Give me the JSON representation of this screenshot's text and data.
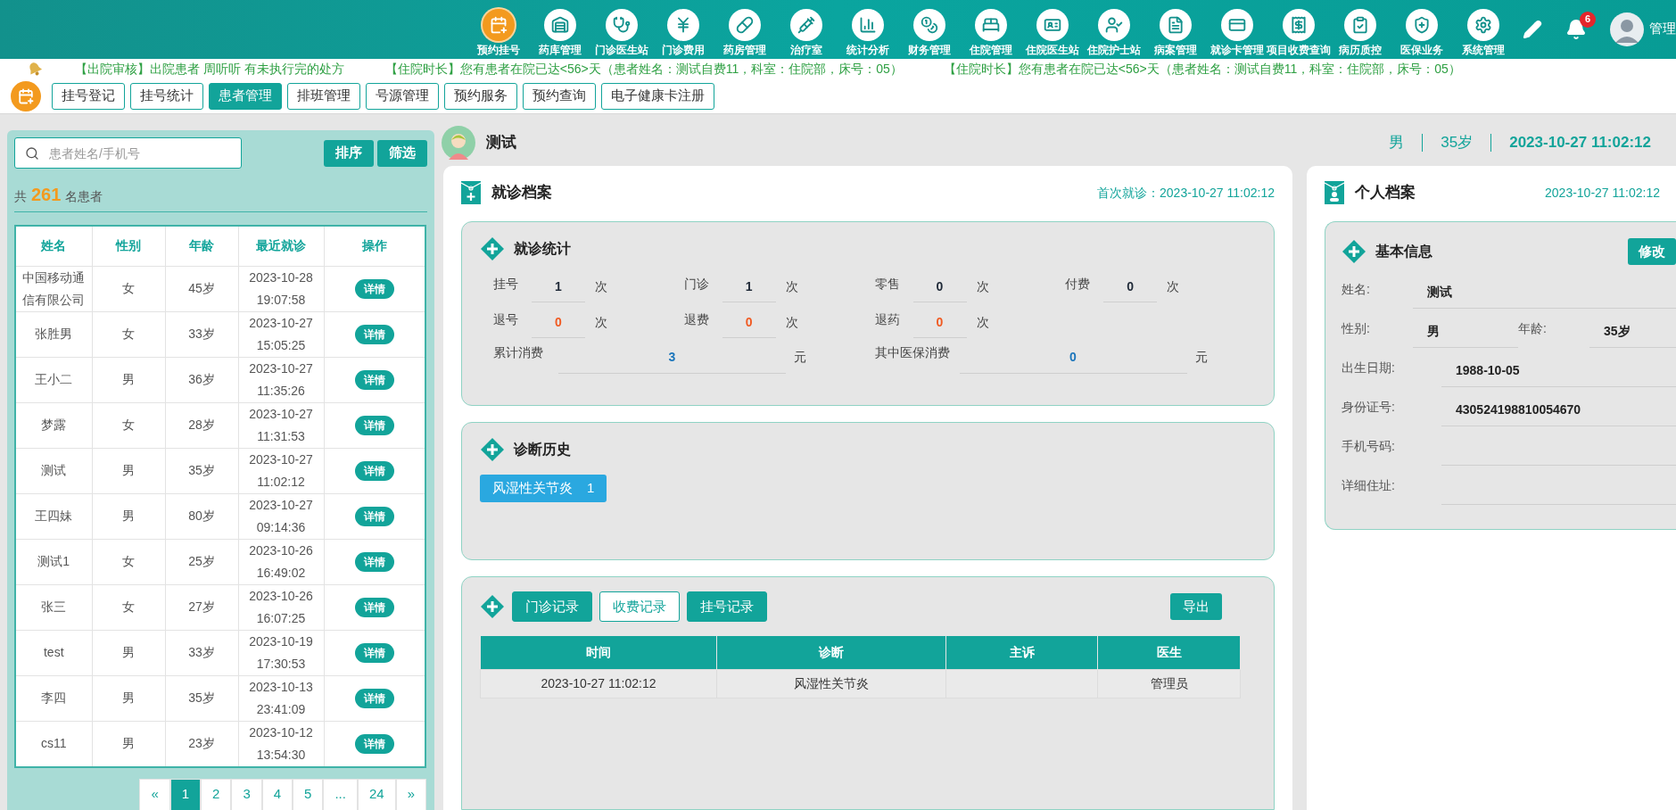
{
  "nav": {
    "items": [
      {
        "label": "预约挂号",
        "selected": true
      },
      {
        "label": "药库管理",
        "selected": false
      },
      {
        "label": "门诊医生站",
        "selected": false
      },
      {
        "label": "门诊费用",
        "selected": false
      },
      {
        "label": "药房管理",
        "selected": false
      },
      {
        "label": "治疗室",
        "selected": false
      },
      {
        "label": "统计分析",
        "selected": false
      },
      {
        "label": "财务管理",
        "selected": false
      },
      {
        "label": "住院管理",
        "selected": false
      },
      {
        "label": "住院医生站",
        "selected": false
      },
      {
        "label": "住院护士站",
        "selected": false
      },
      {
        "label": "病案管理",
        "selected": false
      },
      {
        "label": "就诊卡管理",
        "selected": false
      },
      {
        "label": "项目收费查询",
        "selected": false
      },
      {
        "label": "病历质控",
        "selected": false
      },
      {
        "label": "医保业务",
        "selected": false
      },
      {
        "label": "系统管理",
        "selected": false
      }
    ],
    "notification_count": "6",
    "user": "管理"
  },
  "ticker": [
    "【出院审核】出院患者 周听听 有未执行完的处方",
    "【住院时长】您有患者在院已达<56>天（患者姓名：测试自费11，科室：住院部，床号：05）",
    "【住院时长】您有患者在院已达<56>天（患者姓名：测试自费11，科室：住院部，床号：05）"
  ],
  "tabs": [
    {
      "label": "挂号登记",
      "selected": false
    },
    {
      "label": "挂号统计",
      "selected": false
    },
    {
      "label": "患者管理",
      "selected": true
    },
    {
      "label": "排班管理",
      "selected": false
    },
    {
      "label": "号源管理",
      "selected": false
    },
    {
      "label": "预约服务",
      "selected": false
    },
    {
      "label": "预约查询",
      "selected": false
    },
    {
      "label": "电子健康卡注册",
      "selected": false
    }
  ],
  "patient_list": {
    "search": {
      "placeholder": "患者姓名/手机号"
    },
    "buttons": [
      "排序",
      "筛选"
    ],
    "count": {
      "prefix": "共",
      "value": "261",
      "suffix": "名患者"
    },
    "columns": [
      "姓名",
      "性别",
      "年龄",
      "最近就诊",
      "操作"
    ],
    "rows": [
      {
        "name": "中国移动通信有限公司",
        "sex": "女",
        "age": "45岁",
        "date": "2023-10-28",
        "time": "19:07:58",
        "action": "详情"
      },
      {
        "name": "张胜男",
        "sex": "女",
        "age": "33岁",
        "date": "2023-10-27",
        "time": "15:05:25",
        "action": "详情"
      },
      {
        "name": "王小二",
        "sex": "男",
        "age": "36岁",
        "date": "2023-10-27",
        "time": "11:35:26",
        "action": "详情"
      },
      {
        "name": "梦露",
        "sex": "女",
        "age": "28岁",
        "date": "2023-10-27",
        "time": "11:31:53",
        "action": "详情"
      },
      {
        "name": "测试",
        "sex": "男",
        "age": "35岁",
        "date": "2023-10-27",
        "time": "11:02:12",
        "action": "详情"
      },
      {
        "name": "王四妹",
        "sex": "男",
        "age": "80岁",
        "date": "2023-10-27",
        "time": "09:14:36",
        "action": "详情"
      },
      {
        "name": "测试1",
        "sex": "女",
        "age": "25岁",
        "date": "2023-10-26",
        "time": "16:49:02",
        "action": "详情"
      },
      {
        "name": "张三",
        "sex": "女",
        "age": "27岁",
        "date": "2023-10-26",
        "time": "16:07:25",
        "action": "详情"
      },
      {
        "name": "test",
        "sex": "男",
        "age": "33岁",
        "date": "2023-10-19",
        "time": "17:30:53",
        "action": "详情"
      },
      {
        "name": "李四",
        "sex": "男",
        "age": "35岁",
        "date": "2023-10-13",
        "time": "23:41:09",
        "action": "详情"
      },
      {
        "name": "cs11",
        "sex": "男",
        "age": "23岁",
        "date": "2023-10-12",
        "time": "13:54:30",
        "action": "详情"
      }
    ],
    "pagination": [
      {
        "label": "«",
        "selected": false
      },
      {
        "label": "1",
        "selected": true
      },
      {
        "label": "2",
        "selected": false
      },
      {
        "label": "3",
        "selected": false
      },
      {
        "label": "4",
        "selected": false
      },
      {
        "label": "5",
        "selected": false
      },
      {
        "label": "...",
        "selected": false
      },
      {
        "label": "24",
        "selected": false
      },
      {
        "label": "»",
        "selected": false
      }
    ]
  },
  "patient": {
    "name": "测试",
    "sex": "男",
    "age": "35岁",
    "visit_time": "2023-10-27 11:02:12"
  },
  "visit_file": {
    "title": "就诊档案",
    "first_visit": "首次就诊：2023-10-27 11:02:12",
    "stats": {
      "title": "就诊统计",
      "items": [
        {
          "label": "挂号",
          "value": "1",
          "unit": "次",
          "color": "#1f2937"
        },
        {
          "label": "门诊",
          "value": "1",
          "unit": "次",
          "color": "#1f2937"
        },
        {
          "label": "零售",
          "value": "0",
          "unit": "次",
          "color": "#1f2937"
        },
        {
          "label": "付费",
          "value": "0",
          "unit": "次",
          "color": "#1f2937"
        },
        {
          "label": "退号",
          "value": "0",
          "unit": "次",
          "color": "#f05a22"
        },
        {
          "label": "退费",
          "value": "0",
          "unit": "次",
          "color": "#f05a22"
        },
        {
          "label": "退药",
          "value": "0",
          "unit": "次",
          "color": "#f05a22"
        }
      ],
      "totals": [
        {
          "label": "累计消费",
          "value": "3",
          "unit": "元"
        },
        {
          "label": "其中医保消费",
          "value": "0",
          "unit": "元"
        }
      ]
    },
    "history": {
      "title": "诊断历史",
      "tags": [
        {
          "label": "风湿性关节炎",
          "count": "1"
        }
      ]
    },
    "records": {
      "tabs": [
        {
          "label": "门诊记录",
          "selected": false
        },
        {
          "label": "收费记录",
          "selected": true
        },
        {
          "label": "挂号记录",
          "selected": false
        }
      ],
      "export": "导出",
      "columns": [
        "时间",
        "诊断",
        "主诉",
        "医生"
      ],
      "rows": [
        [
          "2023-10-27 11:02:12",
          "风湿性关节炎",
          "",
          "管理员"
        ]
      ]
    }
  },
  "personal_file": {
    "title": "个人档案",
    "created": "2023-10-27 11:02:12",
    "basic": {
      "title": "基本信息",
      "edit": "修改",
      "rows": [
        [
          {
            "label": "姓名:",
            "value": "测试"
          }
        ],
        [
          {
            "label": "性别:",
            "value": "男"
          },
          {
            "label": "年龄:",
            "value": "35岁"
          }
        ],
        [
          {
            "label": "出生日期:",
            "value": "1988-10-05"
          }
        ],
        [
          {
            "label": "身份证号:",
            "value": "430524198810054670"
          }
        ],
        [
          {
            "label": "手机号码:"
          }
        ],
        [
          {
            "label": "详细住址:"
          }
        ]
      ]
    }
  }
}
